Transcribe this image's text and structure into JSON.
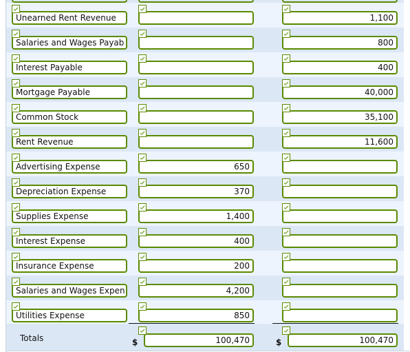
{
  "rows": [
    {
      "account": "Unearned Rent Revenue",
      "debit": "",
      "credit": "1,100"
    },
    {
      "account": "Salaries and Wages Payab",
      "debit": "",
      "credit": "800"
    },
    {
      "account": "Interest Payable",
      "debit": "",
      "credit": "400"
    },
    {
      "account": "Mortgage Payable",
      "debit": "",
      "credit": "40,000"
    },
    {
      "account": "Common Stock",
      "debit": "",
      "credit": "35,100"
    },
    {
      "account": "Rent Revenue",
      "debit": "",
      "credit": "11,600"
    },
    {
      "account": "Advertising Expense",
      "debit": "650",
      "credit": ""
    },
    {
      "account": "Depreciation Expense",
      "debit": "370",
      "credit": ""
    },
    {
      "account": "Supplies Expense",
      "debit": "1,400",
      "credit": ""
    },
    {
      "account": "Interest Expense",
      "debit": "400",
      "credit": ""
    },
    {
      "account": "Insurance Expense",
      "debit": "200",
      "credit": ""
    },
    {
      "account": "Salaries and Wages Expen",
      "debit": "4,200",
      "credit": ""
    },
    {
      "account": "Utilities Expense",
      "debit": "850",
      "credit": ""
    }
  ],
  "totals": {
    "label": "Totals",
    "currency_symbol": "$",
    "debit": "100,470",
    "credit": "100,470"
  },
  "icons": {
    "check": "checkmark-icon"
  },
  "colors": {
    "input_border": "#5a8a00",
    "check_color": "#7aa83a",
    "row_light": "#edf4fd",
    "row_dark": "#dce7f6"
  }
}
